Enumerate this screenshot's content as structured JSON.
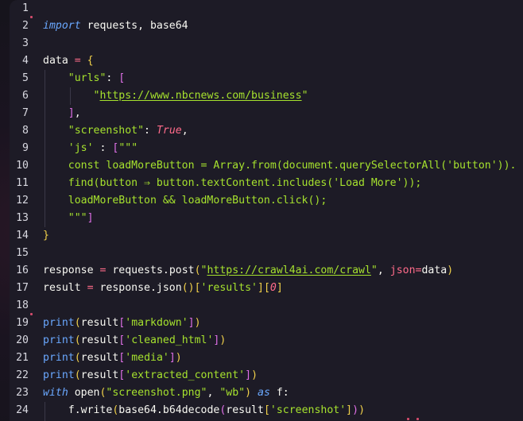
{
  "lines": [
    {
      "n": "1",
      "tokens": []
    },
    {
      "n": "2",
      "tokens": [
        {
          "t": "import",
          "c": "kw-i"
        },
        {
          "t": " requests, base64",
          "c": "id"
        }
      ]
    },
    {
      "n": "3",
      "tokens": []
    },
    {
      "n": "4",
      "tokens": [
        {
          "t": "data ",
          "c": "id"
        },
        {
          "t": "=",
          "c": "op"
        },
        {
          "t": " ",
          "c": "id"
        },
        {
          "t": "{",
          "c": "br"
        }
      ]
    },
    {
      "n": "5",
      "tokens": [
        {
          "t": "    ",
          "c": "id"
        },
        {
          "t": "\"urls\"",
          "c": "str"
        },
        {
          "t": ": ",
          "c": "id"
        },
        {
          "t": "[",
          "c": "br2"
        }
      ]
    },
    {
      "n": "6",
      "tokens": [
        {
          "t": "        ",
          "c": "id"
        },
        {
          "t": "\"",
          "c": "str"
        },
        {
          "t": "https://www.nbcnews.com/business",
          "c": "str-u"
        },
        {
          "t": "\"",
          "c": "str"
        }
      ]
    },
    {
      "n": "7",
      "tokens": [
        {
          "t": "    ",
          "c": "id"
        },
        {
          "t": "]",
          "c": "br2"
        },
        {
          "t": ",",
          "c": "id"
        }
      ]
    },
    {
      "n": "8",
      "tokens": [
        {
          "t": "    ",
          "c": "id"
        },
        {
          "t": "\"screenshot\"",
          "c": "str"
        },
        {
          "t": ": ",
          "c": "id"
        },
        {
          "t": "True",
          "c": "lit"
        },
        {
          "t": ",",
          "c": "id"
        }
      ]
    },
    {
      "n": "9",
      "tokens": [
        {
          "t": "    ",
          "c": "id"
        },
        {
          "t": "'js'",
          "c": "str"
        },
        {
          "t": " : ",
          "c": "id"
        },
        {
          "t": "[",
          "c": "br2"
        },
        {
          "t": "\"\"\"",
          "c": "str"
        }
      ]
    },
    {
      "n": "10",
      "tokens": [
        {
          "t": "    const loadMoreButton = Array.",
          "c": "str"
        },
        {
          "t": "from",
          "c": "str"
        },
        {
          "t": "(document.querySelectorAll('button')).",
          "c": "str"
        }
      ]
    },
    {
      "n": "11",
      "tokens": [
        {
          "t": "    find(button ⇒ button.textContent.includes('Load More'));",
          "c": "str"
        }
      ]
    },
    {
      "n": "12",
      "tokens": [
        {
          "t": "    loadMoreButton && loadMoreButton.click();",
          "c": "str"
        }
      ]
    },
    {
      "n": "13",
      "tokens": [
        {
          "t": "    ",
          "c": "id"
        },
        {
          "t": "\"\"\"",
          "c": "str"
        },
        {
          "t": "]",
          "c": "br2"
        }
      ]
    },
    {
      "n": "14",
      "tokens": [
        {
          "t": "}",
          "c": "br"
        }
      ]
    },
    {
      "n": "15",
      "tokens": []
    },
    {
      "n": "16",
      "tokens": [
        {
          "t": "response ",
          "c": "id"
        },
        {
          "t": "=",
          "c": "op"
        },
        {
          "t": " requests.post",
          "c": "id"
        },
        {
          "t": "(",
          "c": "br"
        },
        {
          "t": "\"",
          "c": "str"
        },
        {
          "t": "https://crawl4ai.com/crawl",
          "c": "str-u"
        },
        {
          "t": "\"",
          "c": "str"
        },
        {
          "t": ", ",
          "c": "id"
        },
        {
          "t": "json",
          "c": "par"
        },
        {
          "t": "=",
          "c": "op"
        },
        {
          "t": "data",
          "c": "id"
        },
        {
          "t": ")",
          "c": "br"
        }
      ]
    },
    {
      "n": "17",
      "tokens": [
        {
          "t": "result ",
          "c": "id"
        },
        {
          "t": "=",
          "c": "op"
        },
        {
          "t": " response.json",
          "c": "id"
        },
        {
          "t": "()",
          "c": "br"
        },
        {
          "t": "[",
          "c": "br"
        },
        {
          "t": "'results'",
          "c": "str"
        },
        {
          "t": "]",
          "c": "br"
        },
        {
          "t": "[",
          "c": "br"
        },
        {
          "t": "0",
          "c": "lit"
        },
        {
          "t": "]",
          "c": "br"
        }
      ]
    },
    {
      "n": "18",
      "tokens": []
    },
    {
      "n": "19",
      "tokens": [
        {
          "t": "print",
          "c": "kw"
        },
        {
          "t": "(",
          "c": "br"
        },
        {
          "t": "result",
          "c": "id"
        },
        {
          "t": "[",
          "c": "br2"
        },
        {
          "t": "'markdown'",
          "c": "str"
        },
        {
          "t": "]",
          "c": "br2"
        },
        {
          "t": ")",
          "c": "br"
        }
      ]
    },
    {
      "n": "20",
      "tokens": [
        {
          "t": "print",
          "c": "kw"
        },
        {
          "t": "(",
          "c": "br"
        },
        {
          "t": "result",
          "c": "id"
        },
        {
          "t": "[",
          "c": "br2"
        },
        {
          "t": "'cleaned_html'",
          "c": "str"
        },
        {
          "t": "]",
          "c": "br2"
        },
        {
          "t": ")",
          "c": "br"
        }
      ]
    },
    {
      "n": "21",
      "tokens": [
        {
          "t": "print",
          "c": "kw"
        },
        {
          "t": "(",
          "c": "br"
        },
        {
          "t": "result",
          "c": "id"
        },
        {
          "t": "[",
          "c": "br2"
        },
        {
          "t": "'media'",
          "c": "str"
        },
        {
          "t": "]",
          "c": "br2"
        },
        {
          "t": ")",
          "c": "br"
        }
      ]
    },
    {
      "n": "22",
      "tokens": [
        {
          "t": "print",
          "c": "kw"
        },
        {
          "t": "(",
          "c": "br"
        },
        {
          "t": "result",
          "c": "id"
        },
        {
          "t": "[",
          "c": "br2"
        },
        {
          "t": "'extracted_content'",
          "c": "str"
        },
        {
          "t": "]",
          "c": "br2"
        },
        {
          "t": ")",
          "c": "br"
        }
      ]
    },
    {
      "n": "23",
      "tokens": [
        {
          "t": "with",
          "c": "kw-i"
        },
        {
          "t": " open",
          "c": "id"
        },
        {
          "t": "(",
          "c": "br"
        },
        {
          "t": "\"screenshot.png\"",
          "c": "str"
        },
        {
          "t": ", ",
          "c": "id"
        },
        {
          "t": "\"wb\"",
          "c": "str"
        },
        {
          "t": ")",
          "c": "br"
        },
        {
          "t": " ",
          "c": "id"
        },
        {
          "t": "as",
          "c": "kw-i"
        },
        {
          "t": " f:",
          "c": "id"
        }
      ]
    },
    {
      "n": "24",
      "tokens": [
        {
          "t": "    f.write",
          "c": "id"
        },
        {
          "t": "(",
          "c": "br"
        },
        {
          "t": "base64.b64decode",
          "c": "id"
        },
        {
          "t": "(",
          "c": "br2"
        },
        {
          "t": "result",
          "c": "id"
        },
        {
          "t": "[",
          "c": "br"
        },
        {
          "t": "'screenshot'",
          "c": "str"
        },
        {
          "t": "]",
          "c": "br"
        },
        {
          "t": ")",
          "c": "br2"
        },
        {
          "t": ")",
          "c": "br"
        }
      ]
    }
  ]
}
